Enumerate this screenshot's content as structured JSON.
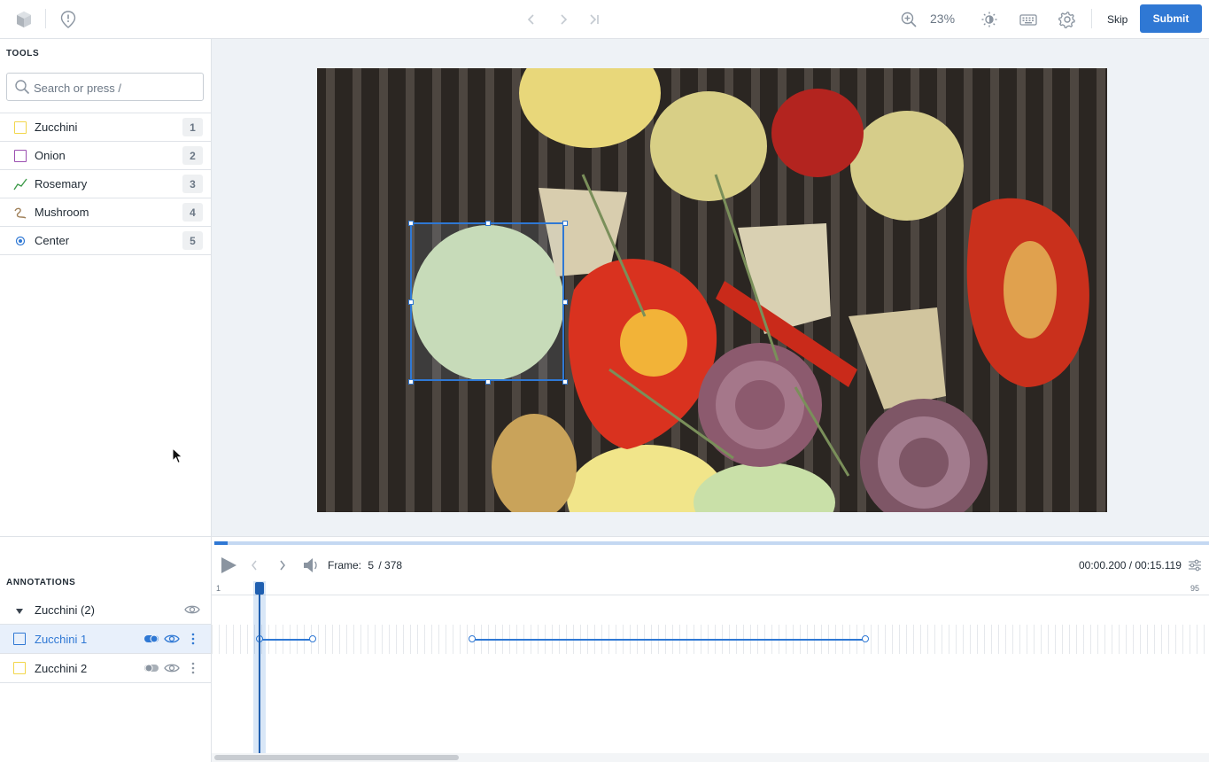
{
  "header": {
    "zoom": "23%",
    "skip_label": "Skip",
    "submit_label": "Submit"
  },
  "tools": {
    "title": "TOOLS",
    "search_placeholder": "Search or press /",
    "items": [
      {
        "label": "Zucchini",
        "key": "1",
        "icon": "bounding-box-icon",
        "color": "#f2d64b"
      },
      {
        "label": "Onion",
        "key": "2",
        "icon": "bounding-box-icon",
        "color": "#9b4fb0"
      },
      {
        "label": "Rosemary",
        "key": "3",
        "icon": "polyline-icon",
        "color": "#3e9a4a"
      },
      {
        "label": "Mushroom",
        "key": "4",
        "icon": "freehand-icon",
        "color": "#a0815a"
      },
      {
        "label": "Center",
        "key": "5",
        "icon": "point-icon",
        "color": "#2f78d4"
      }
    ]
  },
  "player": {
    "frame_label": "Frame:",
    "frame_current": "5",
    "frame_total": "/ 378",
    "time": "00:00.200 / 00:15.119",
    "progress": 0.013,
    "ruler_start": "1",
    "ruler_end": "95"
  },
  "annotations": {
    "title": "ANNOTATIONS",
    "group_label": "Zucchini (2)",
    "items": [
      {
        "label": "Zucchini 1",
        "selected": true,
        "color": "#2f78d4"
      },
      {
        "label": "Zucchini 2",
        "selected": false,
        "color": "#f2d64b"
      }
    ]
  },
  "colors": {
    "accent": "#2f78d4",
    "border": "#dfe3e8",
    "canvas_bg": "#eef2f6"
  }
}
